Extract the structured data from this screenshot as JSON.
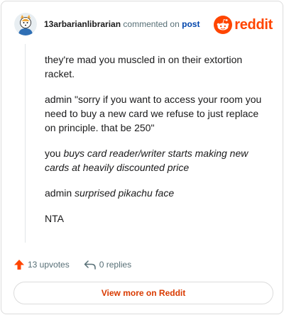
{
  "header": {
    "username": "13arbarianlibrarian",
    "action": "commented on",
    "post_link": "post",
    "brand": "reddit"
  },
  "comment": {
    "paragraph1": "they're mad you muscled in on their extortion racket.",
    "paragraph2": "admin \"sorry if you want to access your room you need to buy a new card we refuse to just replace on principle. that be 250\"",
    "paragraph3_prefix": "you ",
    "paragraph3_italic": "buys card reader/writer starts making new cards at heavily discounted price",
    "paragraph4_prefix": "admin ",
    "paragraph4_italic": "surprised pikachu face",
    "paragraph5": "NTA"
  },
  "footer": {
    "upvotes": "13 upvotes",
    "replies": "0 replies",
    "view_more": "View more on Reddit"
  },
  "colors": {
    "brand": "#ff4500",
    "upvote": "#ff4500",
    "link": "#0045ac",
    "view_more": "#d93a00"
  }
}
